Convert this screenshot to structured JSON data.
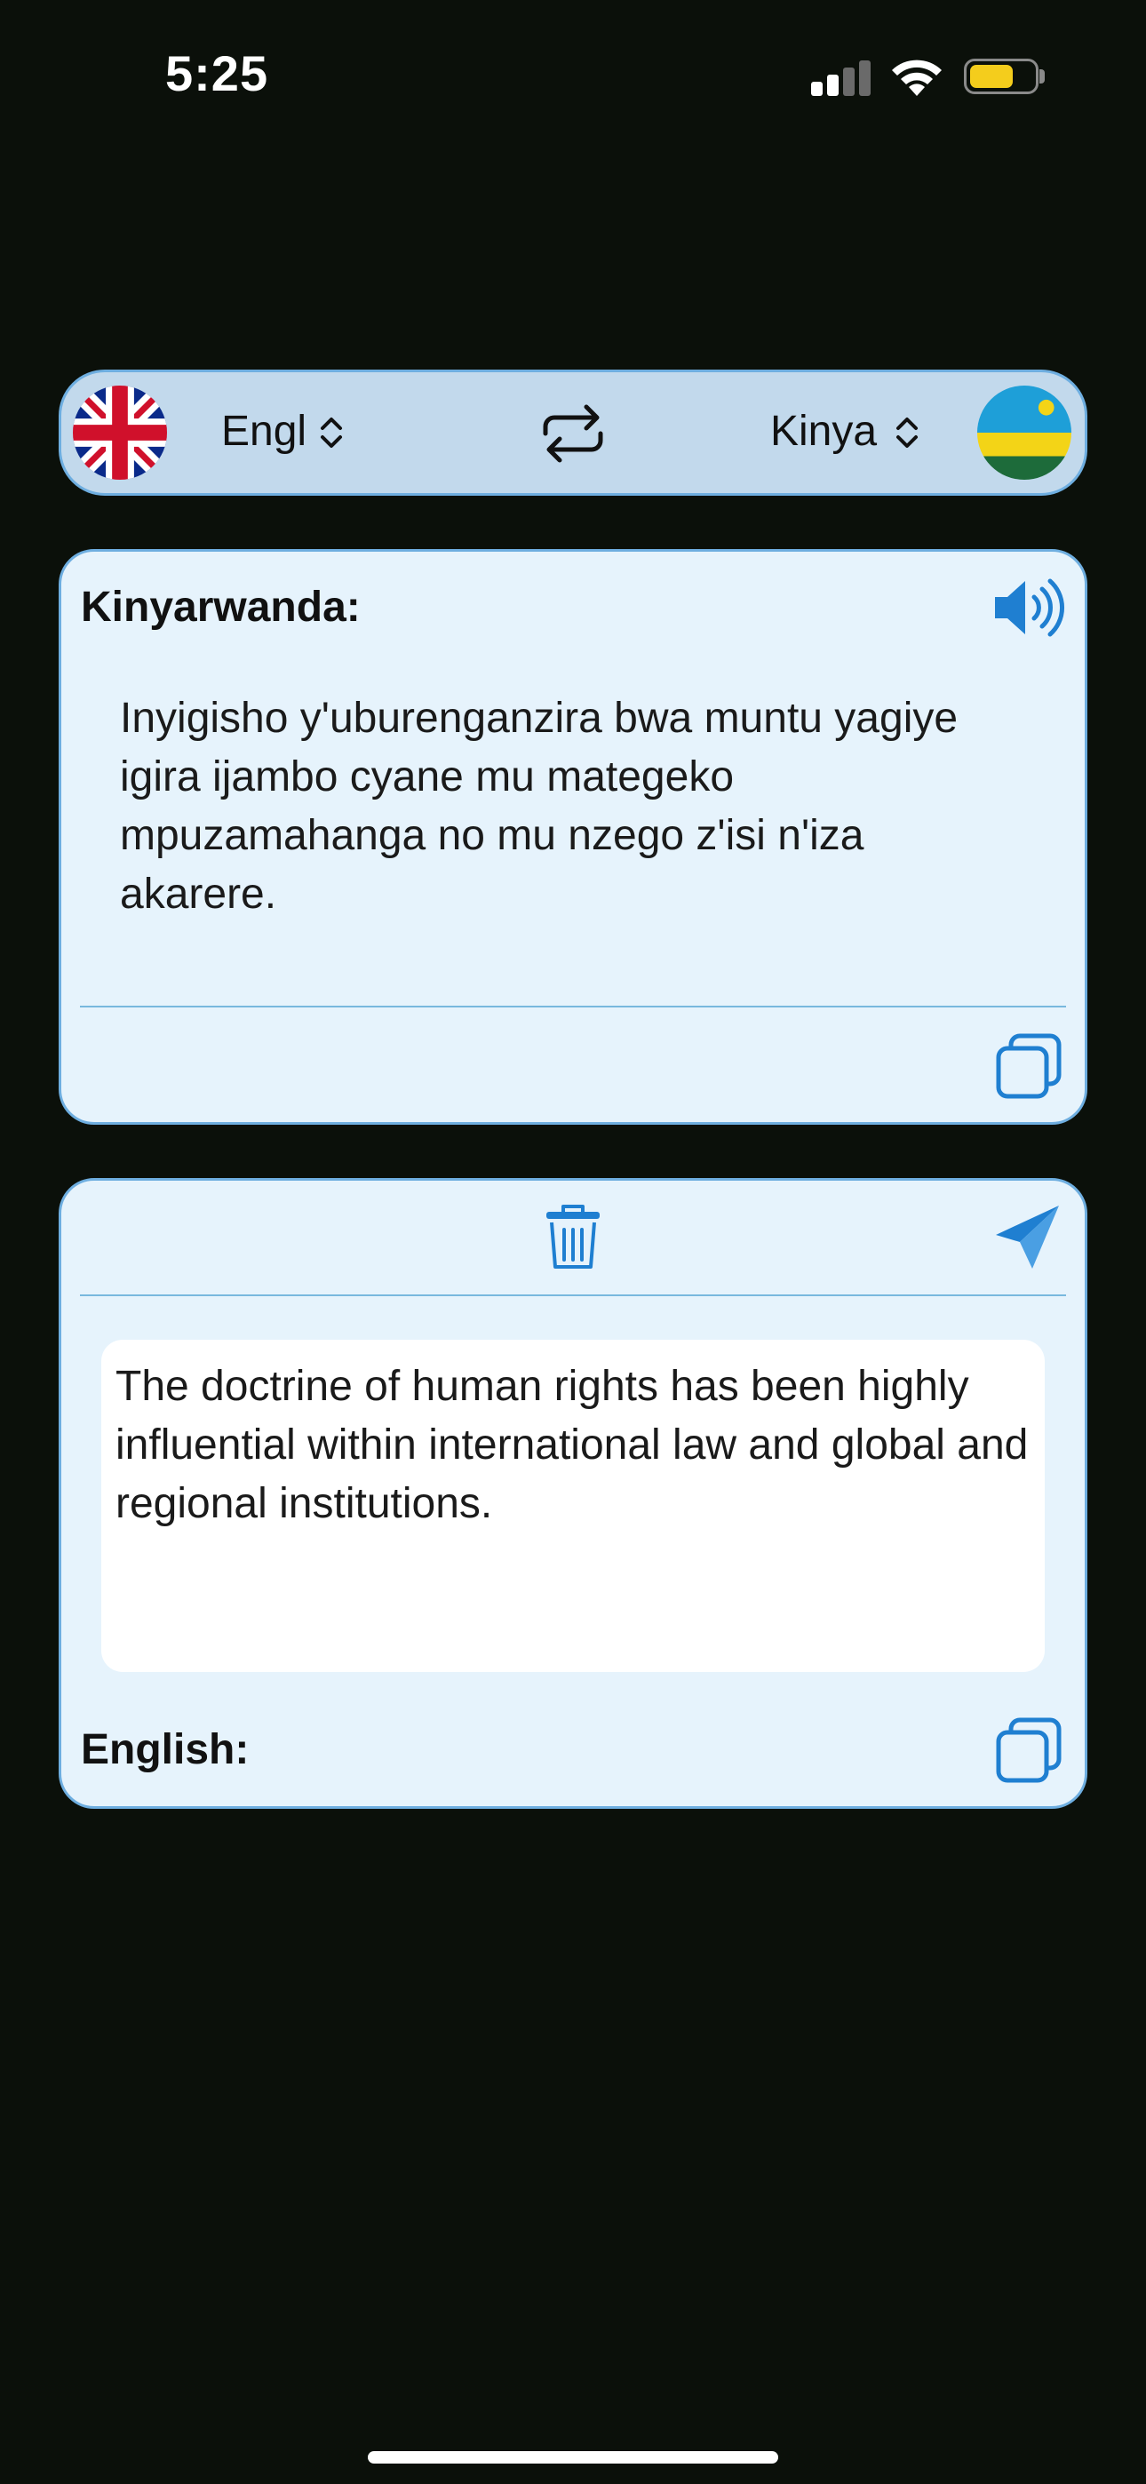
{
  "status_bar": {
    "time": "5:25"
  },
  "language_bar": {
    "source_language": "Engl",
    "target_language": "Kinya",
    "source_flag": "united-kingdom-flag",
    "target_flag": "rwanda-flag",
    "swap_icon": "swap-arrows-icon"
  },
  "translation_card": {
    "title": "Kinyarwanda:",
    "text": "Inyigisho y'uburenganzira bwa muntu yagiye igira ijambo cyane mu mategeko mpuzamahanga no mu nzego z'isi n'iza akarere.",
    "speaker_icon": "speaker-icon",
    "copy_icon": "copy-icon"
  },
  "input_card": {
    "text": "The doctrine of human rights has been highly influential within international law and global and regional institutions.",
    "label": "English:",
    "trash_icon": "trash-icon",
    "send_icon": "send-icon",
    "copy_icon": "copy-icon"
  },
  "colors": {
    "background": "#0b100a",
    "accent": "#1f7fd1",
    "card_bg": "#e6f3fc",
    "bar_bg": "#c2d9ec"
  }
}
